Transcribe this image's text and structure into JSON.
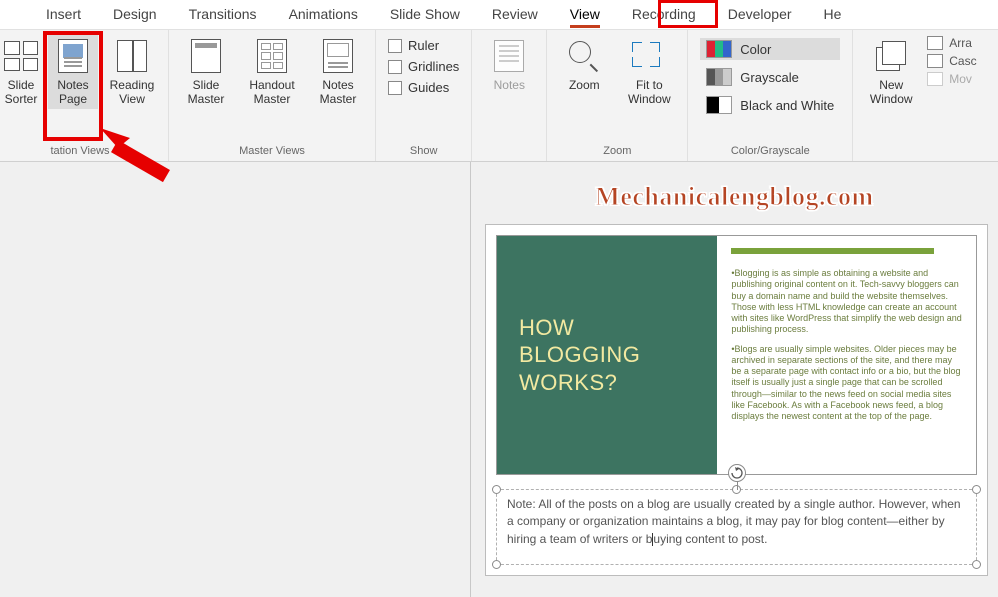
{
  "tabs": {
    "items": [
      {
        "label": "Insert"
      },
      {
        "label": "Design"
      },
      {
        "label": "Transitions"
      },
      {
        "label": "Animations"
      },
      {
        "label": "Slide Show"
      },
      {
        "label": "Review"
      },
      {
        "label": "View"
      },
      {
        "label": "Recording"
      },
      {
        "label": "Developer"
      },
      {
        "label": "He"
      }
    ],
    "active_index": 6
  },
  "ribbon": {
    "presentation_views": {
      "label": "tation Views",
      "slide_sorter": "Slide Sorter",
      "notes_page": "Notes Page",
      "reading_view": "Reading View"
    },
    "master_views": {
      "label": "Master Views",
      "slide_master": "Slide Master",
      "handout_master": "Handout Master",
      "notes_master": "Notes Master"
    },
    "show": {
      "label": "Show",
      "ruler": "Ruler",
      "gridlines": "Gridlines",
      "guides": "Guides"
    },
    "notes": {
      "label": "Notes"
    },
    "zoom": {
      "label": "Zoom",
      "zoom_btn": "Zoom",
      "fit": "Fit to Window"
    },
    "color": {
      "label": "Color/Grayscale",
      "color": "Color",
      "grayscale": "Grayscale",
      "bw": "Black and White"
    },
    "window": {
      "label": "",
      "new_window": "New Window",
      "arrange": "Arra",
      "cascade": "Casc",
      "move": "Mov"
    }
  },
  "watermark": "Mechanicalengblog.com",
  "slide": {
    "title": "HOW BLOGGING WORKS?",
    "para1": "•Blogging is as simple as obtaining a website and publishing original content on it. Tech-savvy bloggers can buy a domain name and build the website themselves. Those with less HTML knowledge can create an account with sites like WordPress that simplify the web design and publishing process.",
    "para2": "•Blogs are usually simple websites. Older pieces may be archived in separate sections of the site, and there may be a separate page with contact info or a bio, but the blog itself is usually just a single page that can be scrolled through—similar to the news feed on social media sites like Facebook. As with a Facebook news feed, a blog displays the newest content at the top of the page."
  },
  "notes_text_a": "Note: All of the posts on a blog are usually created by a single author. However, when a company or organization maintains a blog, it may pay for blog content—either by hiring a team of writers or b",
  "notes_text_b": "uying content to post."
}
